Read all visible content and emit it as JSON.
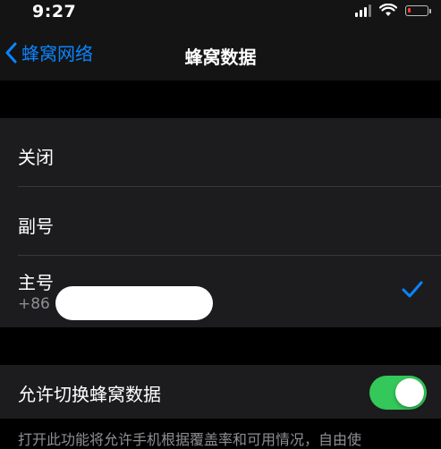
{
  "status_bar": {
    "time": "9:27",
    "icons": [
      "cellular-signal-icon",
      "wifi-icon",
      "battery-icon"
    ],
    "battery_level": 0.15,
    "battery_color": "#ff3b30"
  },
  "nav": {
    "back_label": "蜂窝网络",
    "title": "蜂窝数据",
    "accent_color": "#0a84ff"
  },
  "options": [
    {
      "label": "关闭",
      "selected": false
    },
    {
      "label": "副号",
      "selected": false
    },
    {
      "label": "主号",
      "sublabel": "+86 1",
      "selected": true
    }
  ],
  "toggle": {
    "label": "允许切换蜂窝数据",
    "on": true,
    "on_color": "#34c759"
  },
  "footer_note": "打开此功能将允许手机根据覆盖率和可用情况，自由使"
}
